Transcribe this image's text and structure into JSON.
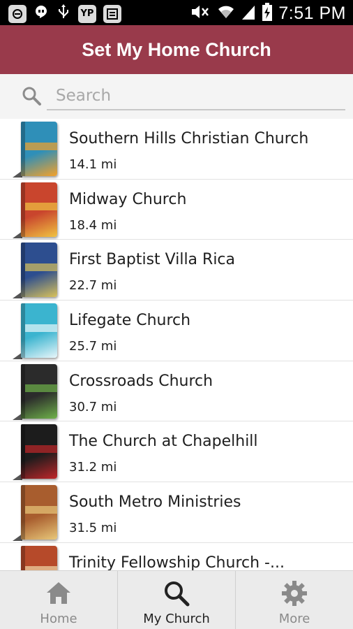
{
  "status_bar": {
    "left_icons": [
      "notification-icon",
      "hangouts-icon",
      "usb-icon",
      "yp-icon",
      "gallery-icon"
    ],
    "yp_label": "YP",
    "right_icons": [
      "mute-icon",
      "wifi-icon",
      "signal-icon",
      "battery-charging-icon"
    ],
    "time": "7:51 PM"
  },
  "header": {
    "title": "Set My Home Church"
  },
  "search": {
    "placeholder": "Search",
    "value": ""
  },
  "churches": [
    {
      "name": "Southern Hills Christian Church",
      "distance": "14.1 mi",
      "cover_color": "#2f8fb8",
      "accent": "#f4a12a"
    },
    {
      "name": "Midway Church",
      "distance": "18.4 mi",
      "cover_color": "#c9452d",
      "accent": "#f0c341"
    },
    {
      "name": "First Baptist Villa Rica",
      "distance": "22.7 mi",
      "cover_color": "#2d4e8f",
      "accent": "#d9c25a"
    },
    {
      "name": "Lifegate Church",
      "distance": "25.7 mi",
      "cover_color": "#3bb4cf",
      "accent": "#e8f6fa"
    },
    {
      "name": "Crossroads Church",
      "distance": "30.7 mi",
      "cover_color": "#2b2b2b",
      "accent": "#6fb24a"
    },
    {
      "name": "The Church at Chapelhill",
      "distance": "31.2 mi",
      "cover_color": "#1c1c1c",
      "accent": "#c0262a"
    },
    {
      "name": "South Metro Ministries",
      "distance": "31.5 mi",
      "cover_color": "#a85d2e",
      "accent": "#e8c87a"
    },
    {
      "name": "Trinity Fellowship Church -...",
      "distance": "",
      "cover_color": "#b64a2a",
      "accent": "#f1d7a8"
    }
  ],
  "nav": {
    "tabs": [
      {
        "label": "Home",
        "icon": "home-icon",
        "active": false
      },
      {
        "label": "My Church",
        "icon": "search-icon",
        "active": true
      },
      {
        "label": "More",
        "icon": "gear-icon",
        "active": false
      }
    ]
  },
  "colors": {
    "header": "#993a4b",
    "tab_icon": "#8a8a8a",
    "tab_icon_active": "#222222"
  }
}
